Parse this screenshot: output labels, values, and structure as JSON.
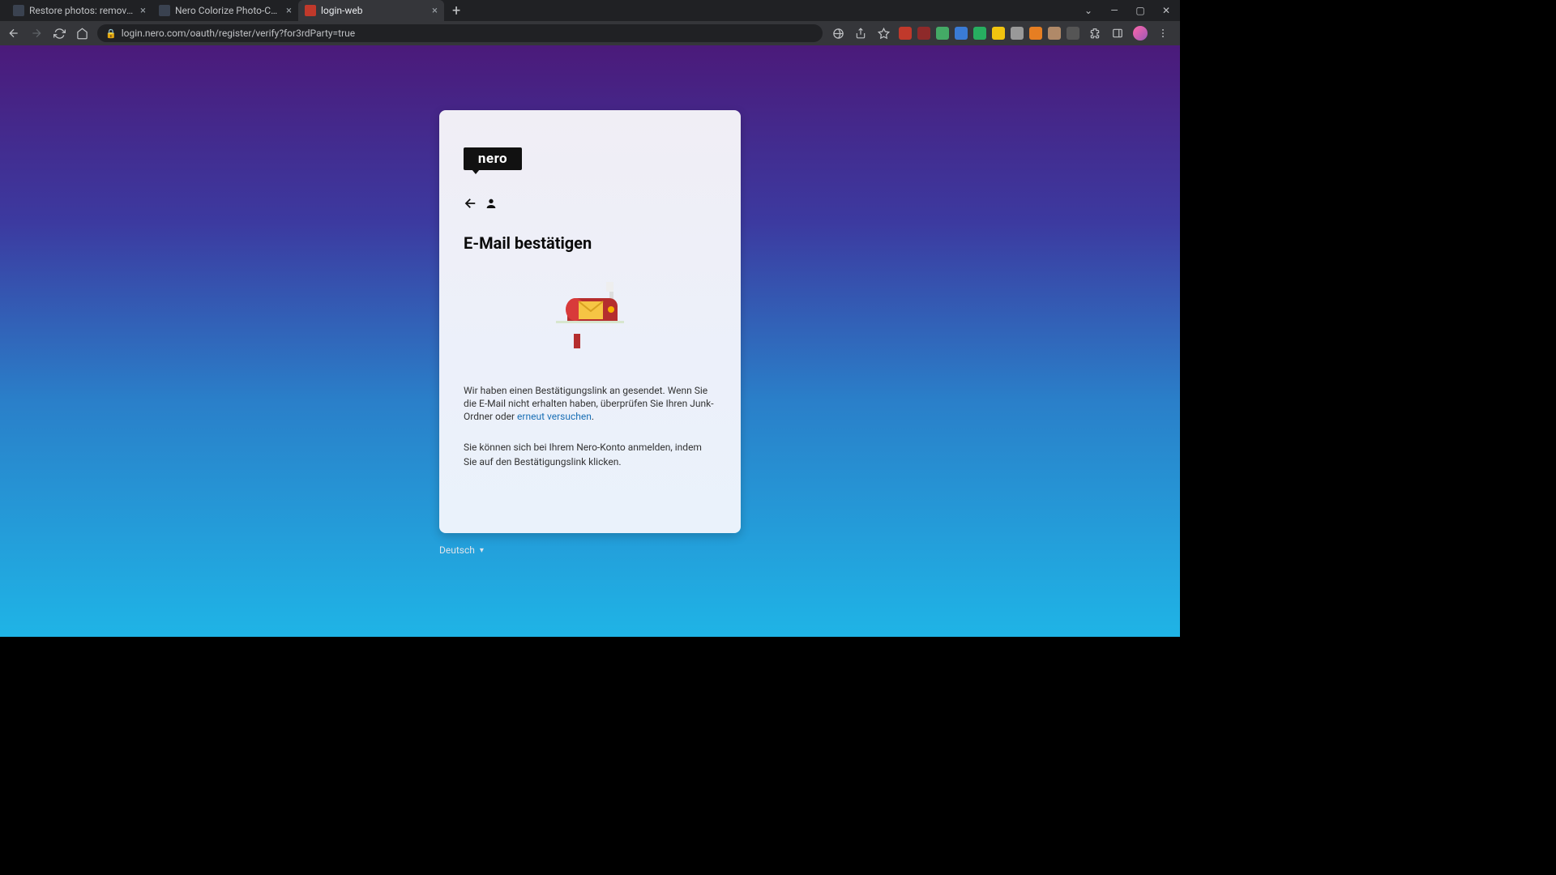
{
  "tabs": [
    {
      "title": "Restore photos: remove scratche"
    },
    {
      "title": "Nero Colorize Photo-Colorize Y"
    },
    {
      "title": "login-web"
    }
  ],
  "url": "login.nero.com/oauth/register/verify?for3rdParty=true",
  "logo": "nero",
  "heading": "E-Mail bestätigen",
  "body1_part1": "Wir haben einen Bestätigungslink an gesendet. Wenn Sie die E-Mail nicht erhalten haben, überprüfen Sie Ihren Junk-Ordner oder ",
  "retry_link": "erneut versuchen",
  "body1_after": ".",
  "body2": "Sie können sich bei Ihrem Nero-Konto anmelden, indem Sie auf den Bestätigungslink klicken.",
  "language": "Deutsch",
  "ext_colors": [
    "#c0392b",
    "#8e2a2a",
    "#4a6",
    "#3a7bd5",
    "#27ae60",
    "#f1c40f",
    "#999",
    "#e67e22",
    "#b08968",
    "#555"
  ]
}
